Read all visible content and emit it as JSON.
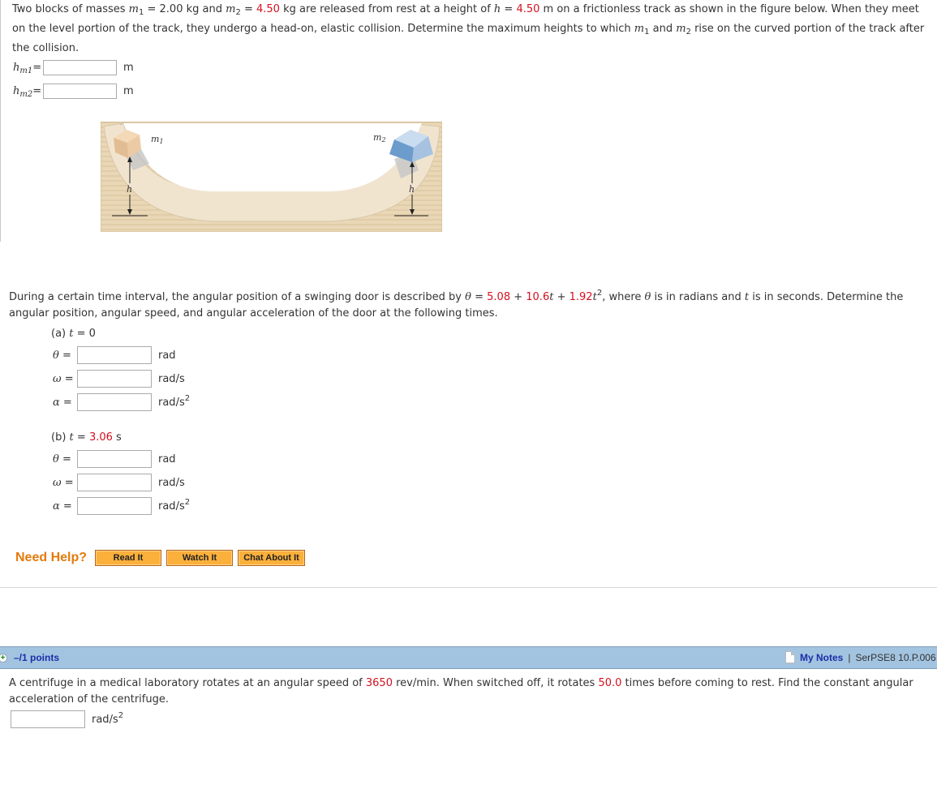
{
  "question1": {
    "text_parts": {
      "p1": "Two blocks of masses ",
      "m1_sym": "m",
      "m1_sub": "1",
      "p2": " = 2.00 kg and ",
      "m2_sym": "m",
      "m2_sub": "2",
      "p3": " = ",
      "m2_value": "4.50",
      "p4": " kg are released from rest at a height of ",
      "h_sym": "h",
      "p5": " = ",
      "h_value": "4.50",
      "p6": " m on a frictionless track as shown in the figure below. When they meet on the level portion of the track, they undergo a head-on, elastic collision. Determine the maximum heights to which ",
      "p7": " and ",
      "p8": " rise on the curved portion of the track after the collision."
    },
    "answers": [
      {
        "label_sym": "h",
        "label_sub": "m1",
        "eq": "=",
        "value": "",
        "unit": "m"
      },
      {
        "label_sym": "h",
        "label_sub": "m2",
        "eq": "=",
        "value": "",
        "unit": "m"
      }
    ],
    "figure": {
      "label_m1": "m",
      "label_m1_sub": "1",
      "label_m2": "m",
      "label_m2_sub": "2",
      "label_h": "h"
    }
  },
  "question2": {
    "text_parts": {
      "p1": "During a certain time interval, the angular position of a swinging door is described by ",
      "theta": "θ",
      "p2": " = ",
      "c0": "5.08",
      "p3": " + ",
      "c1": "10.6",
      "t": "t",
      "p4": " + ",
      "c2": "1.92",
      "p5": ", where ",
      "p6": " is in radians and ",
      "p7": " is in seconds. Determine the angular position, angular speed, and angular acceleration of the door at the following times.",
      "exp": "2"
    },
    "parts": [
      {
        "label_prefix": "(a) ",
        "t_sym": "t",
        "label_eq": " = ",
        "time_value": "0",
        "time_unit": "",
        "rows": [
          {
            "sym": "θ",
            "eq": " =",
            "value": "",
            "unit": "rad",
            "unit_sup": ""
          },
          {
            "sym": "ω",
            "eq": " =",
            "value": "",
            "unit": "rad/s",
            "unit_sup": ""
          },
          {
            "sym": "α",
            "eq": " =",
            "value": "",
            "unit": "rad/s",
            "unit_sup": "2"
          }
        ]
      },
      {
        "label_prefix": "(b) ",
        "t_sym": "t",
        "label_eq": " = ",
        "time_value": "3.06",
        "time_unit": " s",
        "rows": [
          {
            "sym": "θ",
            "eq": " =",
            "value": "",
            "unit": "rad",
            "unit_sup": ""
          },
          {
            "sym": "ω",
            "eq": " =",
            "value": "",
            "unit": "rad/s",
            "unit_sup": ""
          },
          {
            "sym": "α",
            "eq": " =",
            "value": "",
            "unit": "rad/s",
            "unit_sup": "2"
          }
        ]
      }
    ]
  },
  "help": {
    "title": "Need Help?",
    "buttons": [
      "Read It",
      "Watch It",
      "Chat About It"
    ]
  },
  "question3": {
    "header": {
      "expand_icon": "plus-icon",
      "points": "–/1 points",
      "notes_icon": "note-icon",
      "my_notes": "My Notes",
      "separator": "|",
      "question_id": "SerPSE8 10.P.006"
    },
    "text_parts": {
      "p1": "A centrifuge in a medical laboratory rotates at an angular speed of ",
      "speed": "3650",
      "p2": " rev/min. When switched off, it rotates ",
      "turns": "50.0",
      "p3": " times before coming to rest. Find the constant angular acceleration of the centrifuge."
    },
    "answer": {
      "value": "",
      "unit": "rad/s",
      "unit_sup": "2"
    }
  },
  "colors": {
    "variable_red": "#d4101f",
    "help_orange": "#e47a0b",
    "button_orange": "#fbb03b",
    "header_blue": "#a3c4e0",
    "link_blue": "#1a2fa8"
  }
}
